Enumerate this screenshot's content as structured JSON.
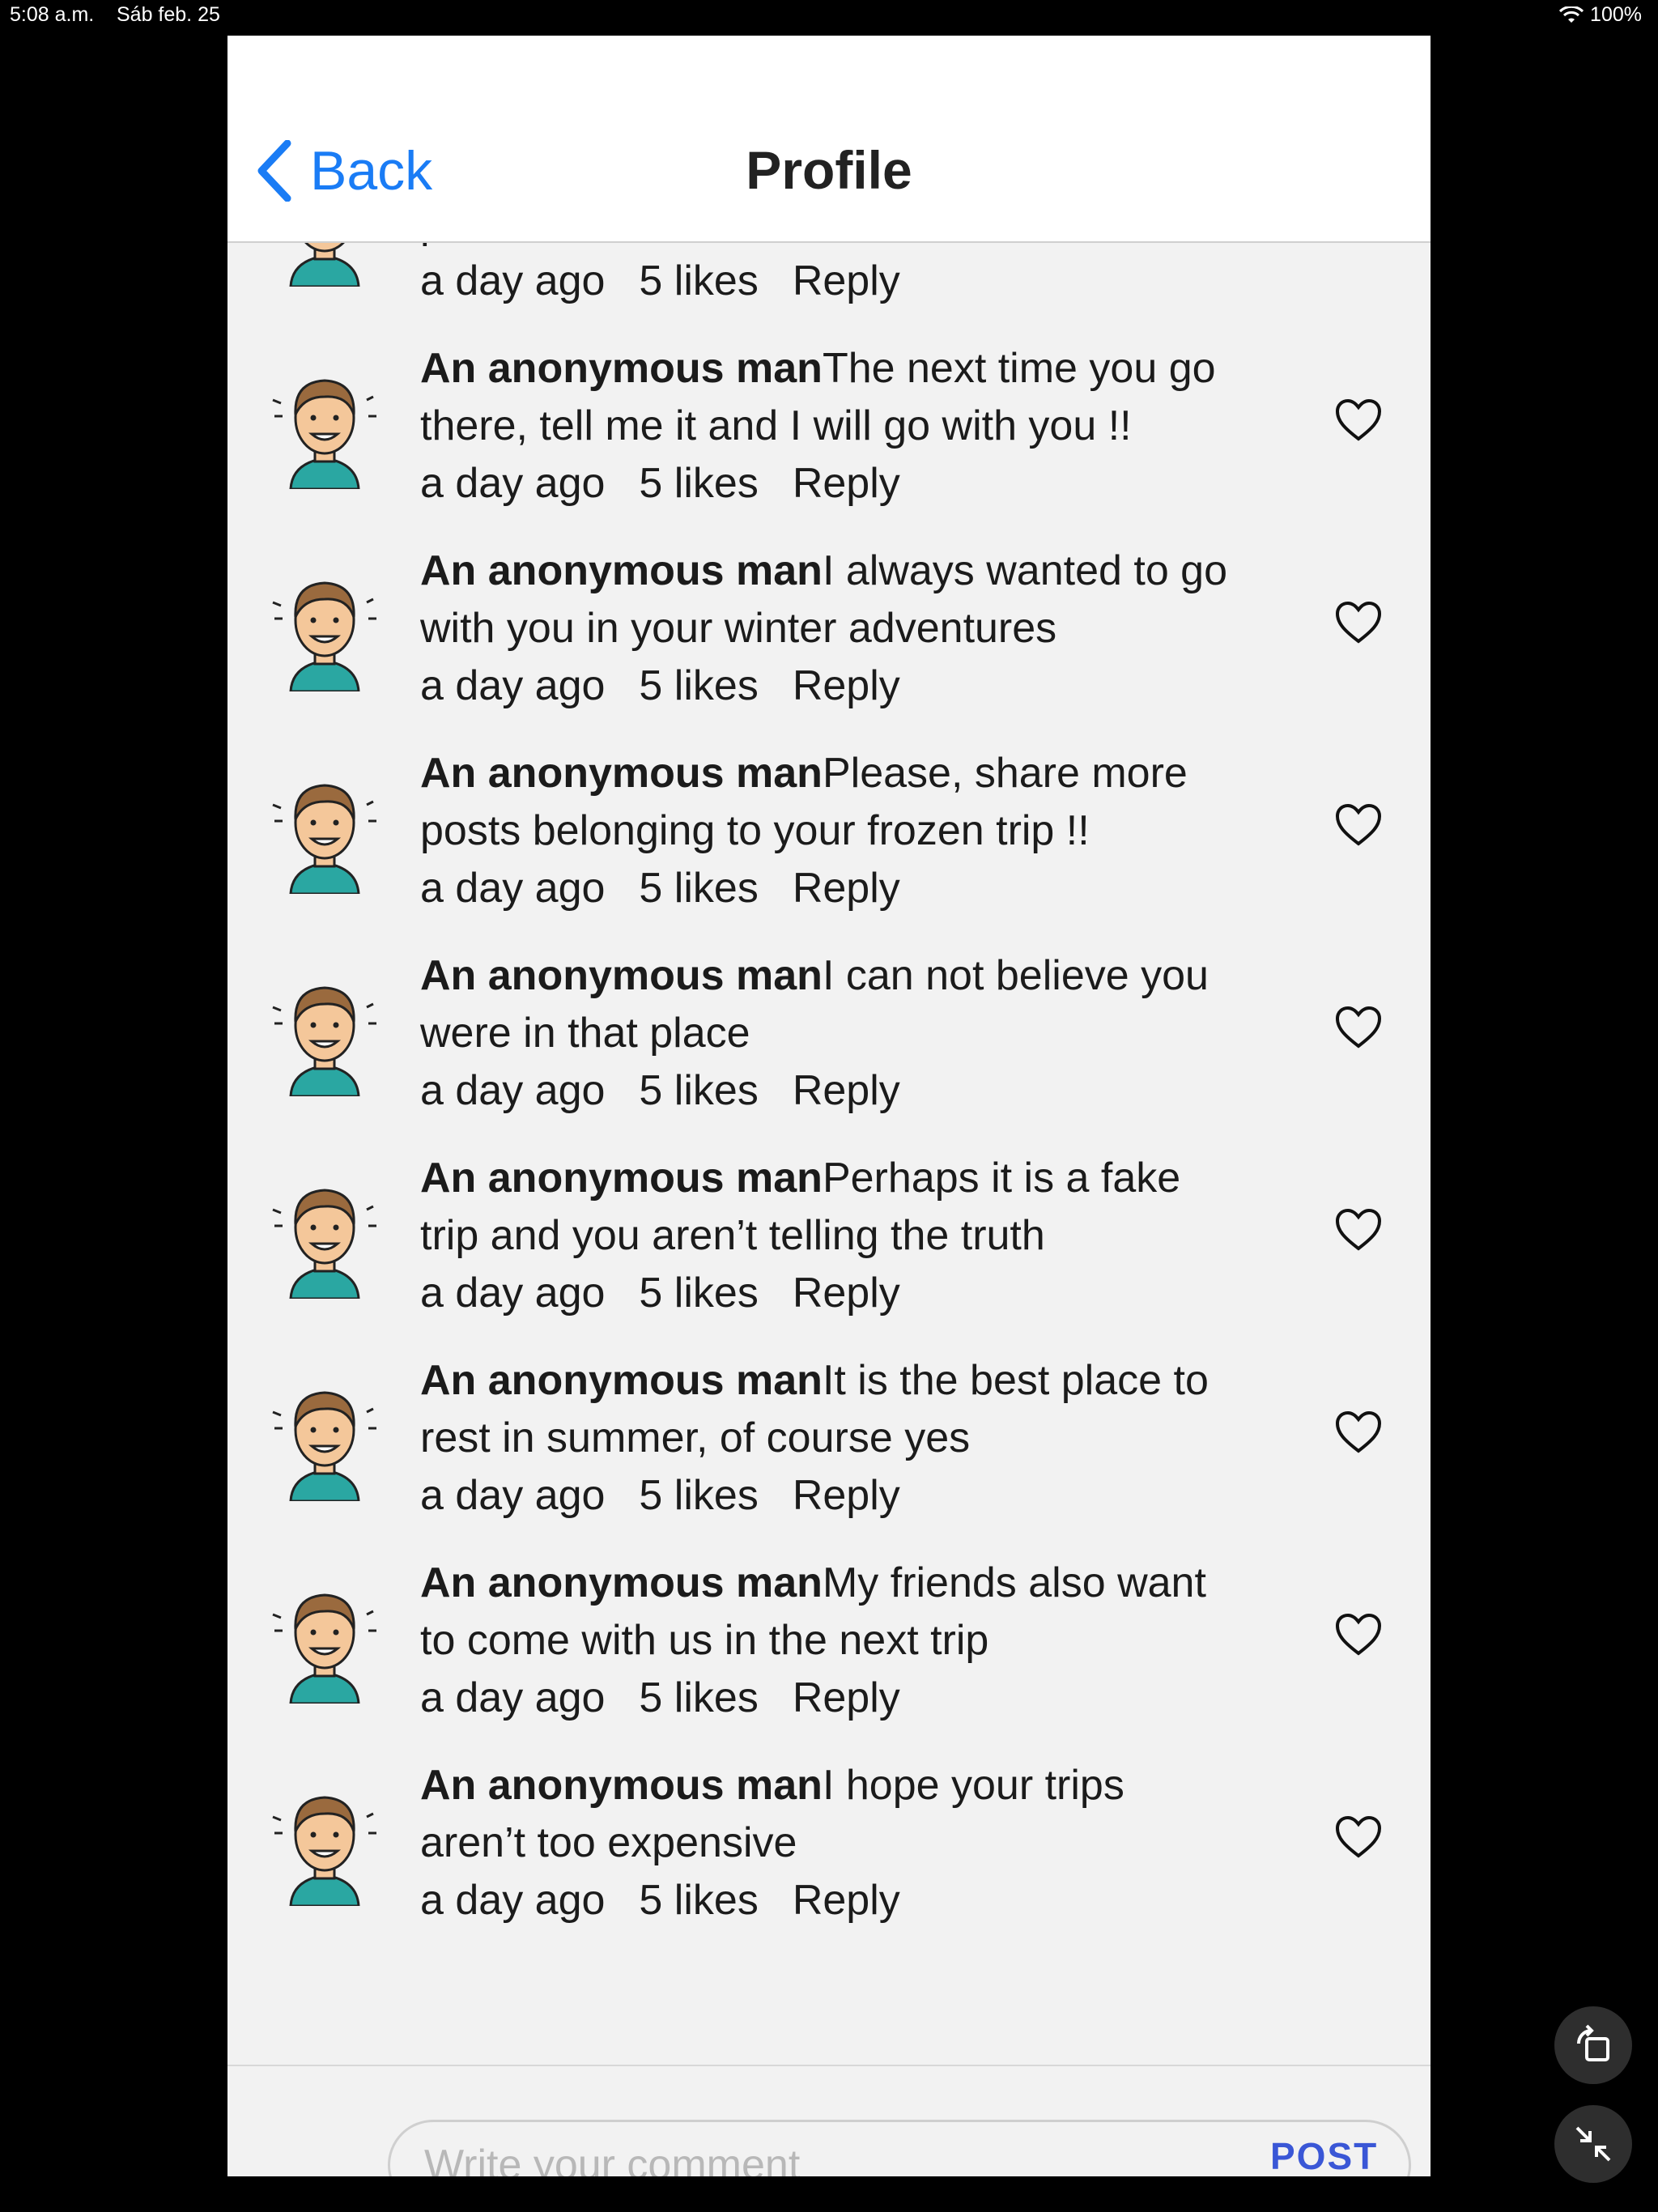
{
  "status": {
    "time": "5:08 a.m.",
    "date": "Sáb feb. 25",
    "battery": "100%"
  },
  "nav": {
    "back_label": "Back",
    "title": "Profile"
  },
  "first_comment": {
    "text_line2": "place. It’s wonderful",
    "time": "a day ago",
    "likes": "5 likes",
    "reply": "Reply"
  },
  "comments": [
    {
      "author": "An anonymous man",
      "line1": "The next time you go",
      "line2": "there, tell me it and I will go with you !!",
      "time": "a day ago",
      "likes": "5 likes",
      "reply": "Reply"
    },
    {
      "author": "An anonymous man",
      "line1": "I always wanted to go",
      "line2": "with you in your winter adventures",
      "time": "a day ago",
      "likes": "5 likes",
      "reply": "Reply"
    },
    {
      "author": "An anonymous man",
      "line1": "Please, share more",
      "line2": "posts belonging to your frozen trip !!",
      "time": "a day ago",
      "likes": "5 likes",
      "reply": "Reply"
    },
    {
      "author": "An anonymous man",
      "line1": "I can not believe you",
      "line2": "were in that place",
      "time": "a day ago",
      "likes": "5 likes",
      "reply": "Reply"
    },
    {
      "author": "An anonymous man",
      "line1": "Perhaps it is a fake",
      "line2": "trip and you aren’t telling the truth",
      "time": "a day ago",
      "likes": "5 likes",
      "reply": "Reply"
    },
    {
      "author": "An anonymous man",
      "line1": "It is the best place to",
      "line2": "rest in summer, of course yes",
      "time": "a day ago",
      "likes": "5 likes",
      "reply": "Reply"
    },
    {
      "author": "An anonymous man",
      "line1": "My friends also want",
      "line2": "to come with us in the next trip",
      "time": "a day ago",
      "likes": "5 likes",
      "reply": "Reply"
    },
    {
      "author": "An anonymous man",
      "line1": "I hope your trips",
      "line2": "aren’t too expensive",
      "time": "a day ago",
      "likes": "5 likes",
      "reply": "Reply"
    }
  ],
  "composer": {
    "placeholder": "Write your comment",
    "post_label": "POST"
  },
  "colors": {
    "accent_blue": "#1a7cf5",
    "post_blue": "#3a57d6",
    "panel_bg": "#f2f2f2"
  }
}
